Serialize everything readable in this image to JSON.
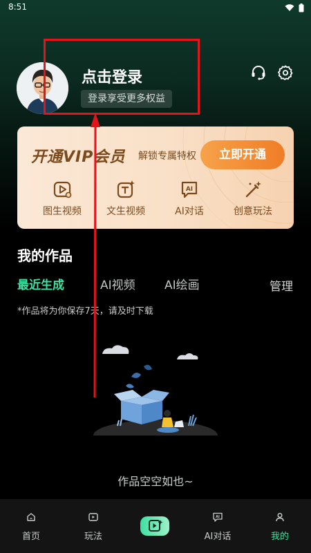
{
  "status": {
    "time": "8:51"
  },
  "profile": {
    "login_title": "点击登录",
    "login_subtitle": "登录享受更多权益"
  },
  "vip": {
    "title": "开通VIP会员",
    "description": "解锁专属特权",
    "button_label": "立即开通",
    "features": [
      {
        "label": "图生视频",
        "icon": "image-to-video-icon"
      },
      {
        "label": "文生视频",
        "icon": "text-to-video-icon"
      },
      {
        "label": "AI对话",
        "icon": "ai-chat-icon"
      },
      {
        "label": "创意玩法",
        "icon": "magic-wand-icon"
      }
    ]
  },
  "works": {
    "title": "我的作品",
    "tabs": [
      {
        "label": "最近生成",
        "active": true
      },
      {
        "label": "AI视频",
        "active": false
      },
      {
        "label": "AI绘画",
        "active": false
      }
    ],
    "manage_label": "管理",
    "notice": "*作品将为你保存7天，请及时下载",
    "empty_text": "作品空空如也~"
  },
  "bottom_nav": {
    "items": [
      {
        "label": "首页",
        "icon": "home-icon",
        "active": false
      },
      {
        "label": "玩法",
        "icon": "play-icon",
        "active": false
      },
      {
        "label": "AI对话",
        "icon": "ai-chat-icon",
        "active": false
      },
      {
        "label": "我的",
        "icon": "profile-icon",
        "active": true
      }
    ],
    "create_icon": "create-video-icon"
  },
  "colors": {
    "accent": "#3fe0a2",
    "annotation_red": "#e3141b",
    "vip_orange": "#f07d26"
  }
}
